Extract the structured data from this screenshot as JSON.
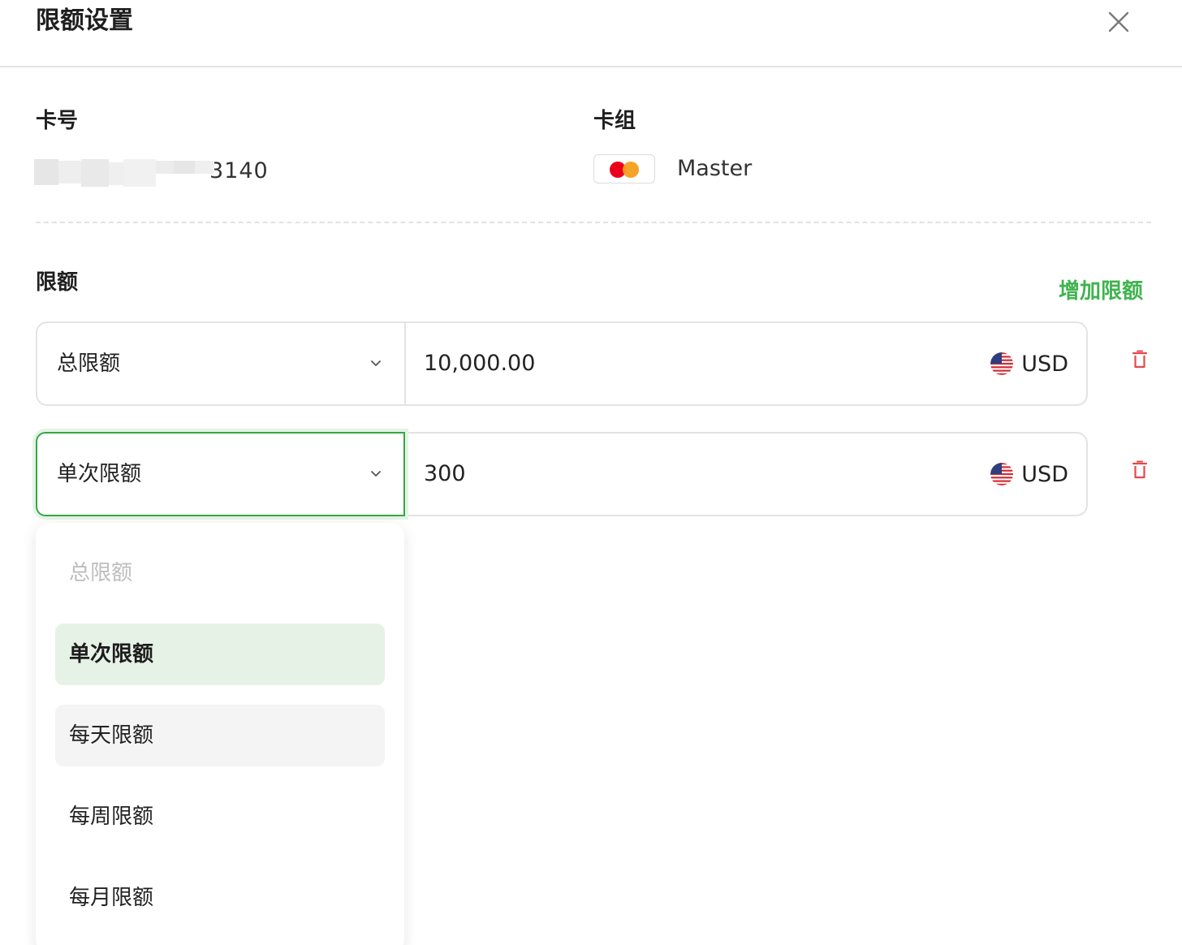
{
  "dialog": {
    "title": "限额设置",
    "close_icon": "close-icon"
  },
  "card": {
    "number_label": "卡号",
    "number_suffix": "3140",
    "group_label": "卡组",
    "brand_icon": "mastercard-logo",
    "brand_name": "Master"
  },
  "limits": {
    "section_label": "限额",
    "add_label": "增加限额",
    "accent_color": "#3fb34f",
    "delete_color": "#e5484d",
    "rows": [
      {
        "type": "总限额",
        "amount": "10,000.00",
        "currency": "USD",
        "currency_icon": "us-flag-icon"
      },
      {
        "type": "单次限额",
        "amount": "300",
        "currency": "USD",
        "currency_icon": "us-flag-icon"
      }
    ]
  },
  "dropdown": {
    "options": [
      {
        "label": "总限额",
        "state": "disabled"
      },
      {
        "label": "单次限额",
        "state": "selected"
      },
      {
        "label": "每天限额",
        "state": "hover"
      },
      {
        "label": "每周限额",
        "state": "normal"
      },
      {
        "label": "每月限额",
        "state": "normal"
      }
    ]
  }
}
